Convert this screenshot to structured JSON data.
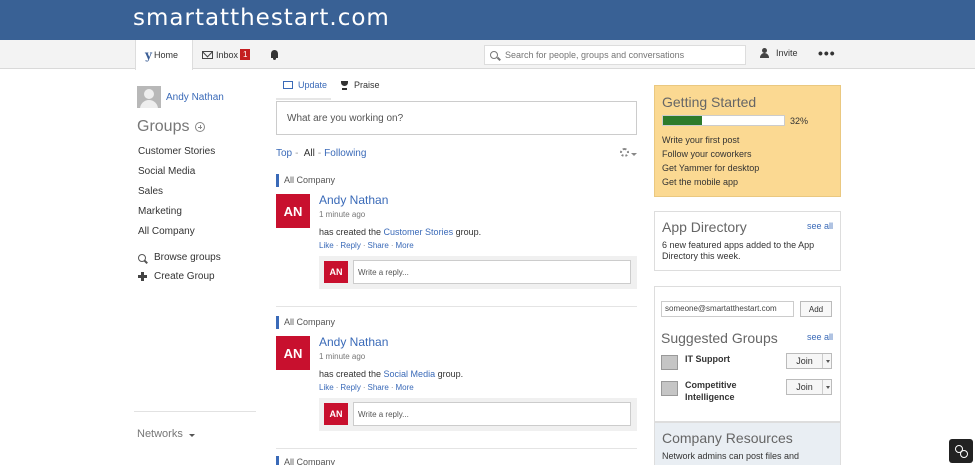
{
  "banner": {
    "network_name": "smartatthestart.com"
  },
  "nav": {
    "home_logo": "y",
    "home_label": "Home",
    "inbox_label": "Inbox",
    "inbox_count": "1",
    "search_placeholder": "Search for people, groups and conversations",
    "invite_label": "Invite",
    "more_label": "•••"
  },
  "sidebar": {
    "user_name": "Andy Nathan",
    "groups_heading": "Groups",
    "groups": [
      "Customer Stories",
      "Social Media",
      "Sales",
      "Marketing",
      "All Company"
    ],
    "browse_groups": "Browse groups",
    "create_group": "Create Group",
    "networks_label": "Networks"
  },
  "feed": {
    "tabs": {
      "update": "Update",
      "praise": "Praise"
    },
    "composer_placeholder": "What are you working on?",
    "filters": {
      "top": "Top",
      "all": "All",
      "following": "Following"
    },
    "threads": [
      {
        "group": "All Company",
        "avatar_initials": "AN",
        "author": "Andy Nathan",
        "time": "1 minute ago",
        "body_prefix": "has created the ",
        "body_link": "Customer Stories",
        "body_suffix": " group.",
        "actions": [
          "Like",
          "Reply",
          "Share",
          "More"
        ],
        "reply_placeholder": "Write a reply..."
      },
      {
        "group": "All Company",
        "avatar_initials": "AN",
        "author": "Andy Nathan",
        "time": "1 minute ago",
        "body_prefix": "has created the ",
        "body_link": "Social Media",
        "body_suffix": " group.",
        "actions": [
          "Like",
          "Reply",
          "Share",
          "More"
        ],
        "reply_placeholder": "Write a reply..."
      },
      {
        "group": "All Company"
      }
    ]
  },
  "right": {
    "getting_started": {
      "title": "Getting Started",
      "progress": 0.32,
      "progress_label": "32%",
      "items": [
        "Write your first post",
        "Follow your coworkers",
        "Get Yammer for desktop",
        "Get the mobile app"
      ]
    },
    "app_directory": {
      "title": "App Directory",
      "see_all": "see all",
      "description": "6 new featured apps added to the App Directory this week."
    },
    "suggested_groups": {
      "email_value": "someone@smartatthestart.com",
      "add_label": "Add",
      "title": "Suggested Groups",
      "see_all": "see all",
      "groups": [
        {
          "name": "IT Support",
          "join_label": "Join"
        },
        {
          "name": "Competitive Intelligence",
          "join_label": "Join"
        }
      ]
    },
    "company_resources": {
      "title": "Company Resources",
      "description": "Network admins can post files and"
    }
  },
  "colors": {
    "banner": "#396195",
    "link": "#3a6ab8",
    "avatar_red": "#c8102e",
    "progress_green": "#2d7b2a",
    "getting_started_bg": "#fbd992"
  }
}
